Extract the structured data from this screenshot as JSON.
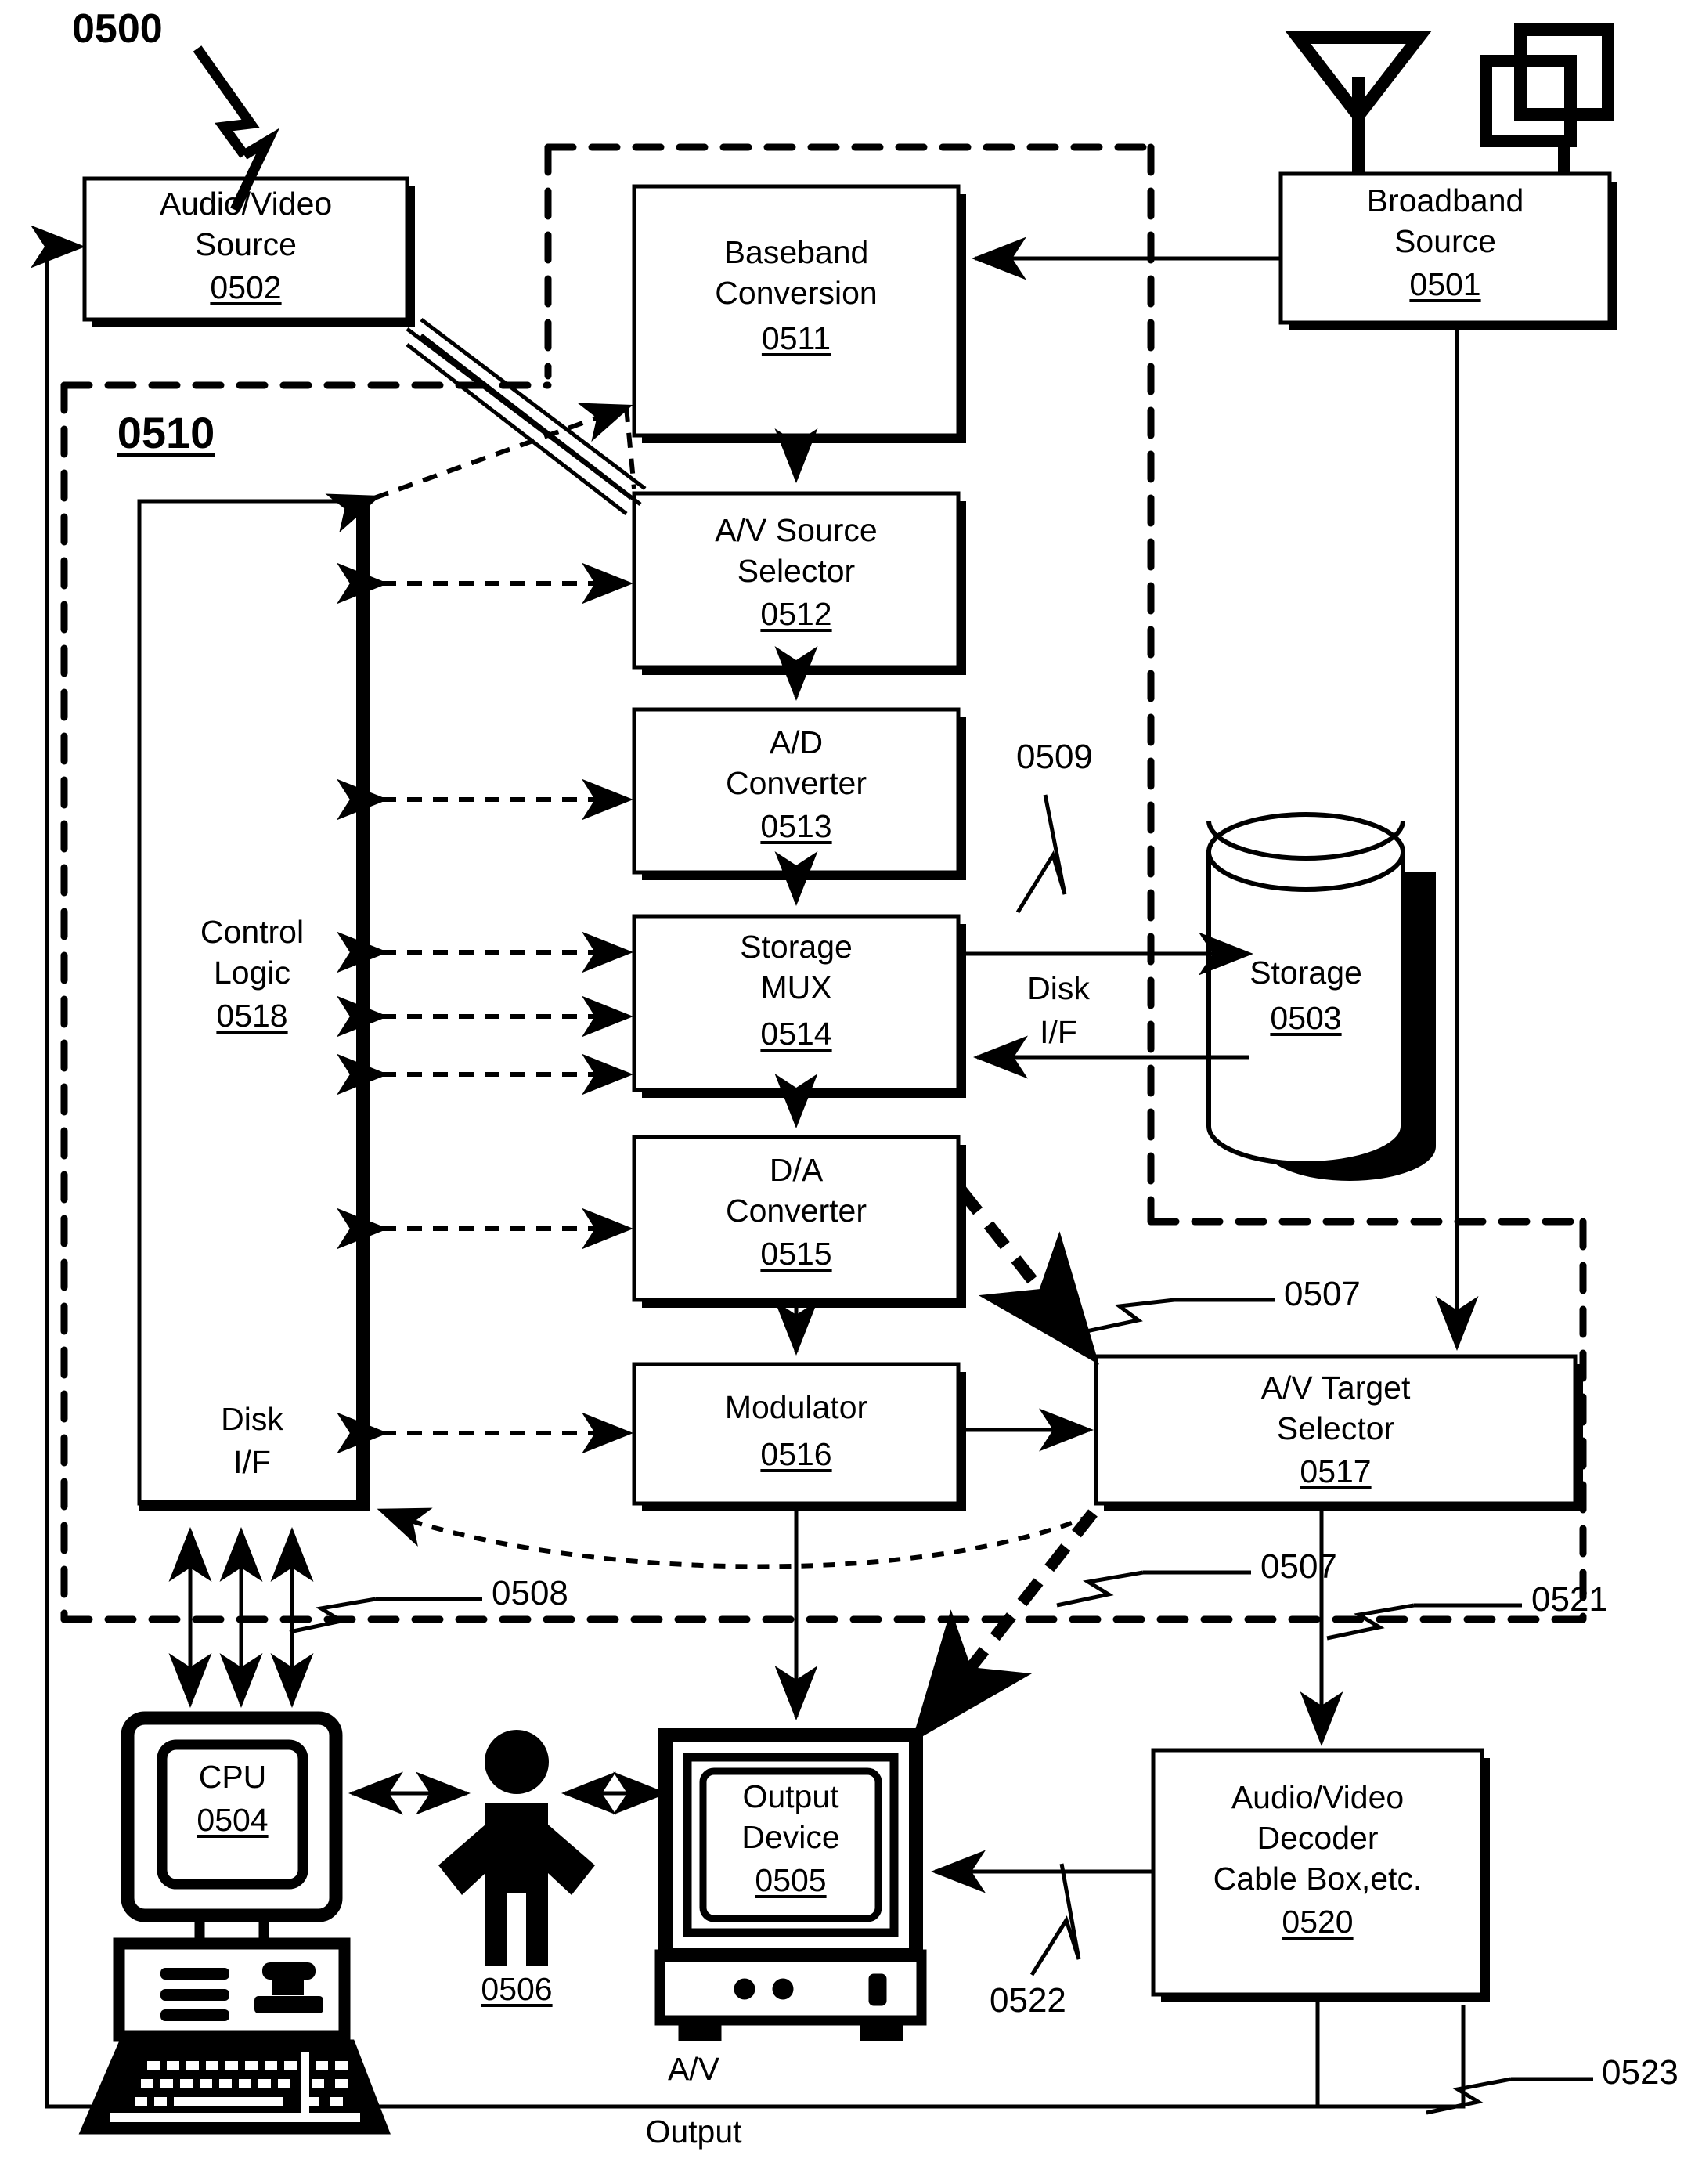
{
  "figure": {
    "number": "0500",
    "system_group": "0510"
  },
  "boxes": {
    "av_source": {
      "line1": "Audio/Video",
      "line2": "Source",
      "ref": "0502"
    },
    "broadband": {
      "line1": "Broadband",
      "line2": "Source",
      "ref": "0501"
    },
    "baseband": {
      "line1": "Baseband",
      "line2": "Conversion",
      "ref": "0511"
    },
    "av_src_sel": {
      "line1": "A/V Source",
      "line2": "Selector",
      "ref": "0512"
    },
    "ad_conv": {
      "line1": "A/D",
      "line2": "Converter",
      "ref": "0513"
    },
    "storage_mux": {
      "line1": "Storage",
      "line2": "MUX",
      "ref": "0514"
    },
    "da_conv": {
      "line1": "D/A",
      "line2": "Converter",
      "ref": "0515"
    },
    "modulator": {
      "line1": "Modulator",
      "line2": "",
      "ref": "0516"
    },
    "av_tgt_sel": {
      "line1": "A/V Target",
      "line2": "Selector",
      "ref": "0517"
    },
    "control": {
      "line1": "Control",
      "line2": "Logic",
      "ref": "0518",
      "sub1": "Disk",
      "sub2": "I/F"
    },
    "storage": {
      "line1": "Storage",
      "ref": "0503"
    },
    "cpu": {
      "line1": "CPU",
      "ref": "0504"
    },
    "output_dev": {
      "line1": "Output",
      "line2": "Device",
      "ref": "0505"
    },
    "user": {
      "ref": "0506"
    },
    "decoder": {
      "line1": "Audio/Video",
      "line2": "Decoder",
      "line3": "Cable Box,etc.",
      "ref": "0520"
    }
  },
  "labels": {
    "disk_if_mid": {
      "line1": "Disk",
      "line2": "I/F"
    },
    "av_output": {
      "line1": "A/V",
      "line2": "Output"
    }
  },
  "callouts": {
    "c0507_upper": "0507",
    "c0507_lower": "0507",
    "c0508": "0508",
    "c0509": "0509",
    "c0521": "0521",
    "c0522": "0522",
    "c0523": "0523"
  },
  "colors": {
    "ink": "#000000",
    "paper": "#ffffff"
  }
}
